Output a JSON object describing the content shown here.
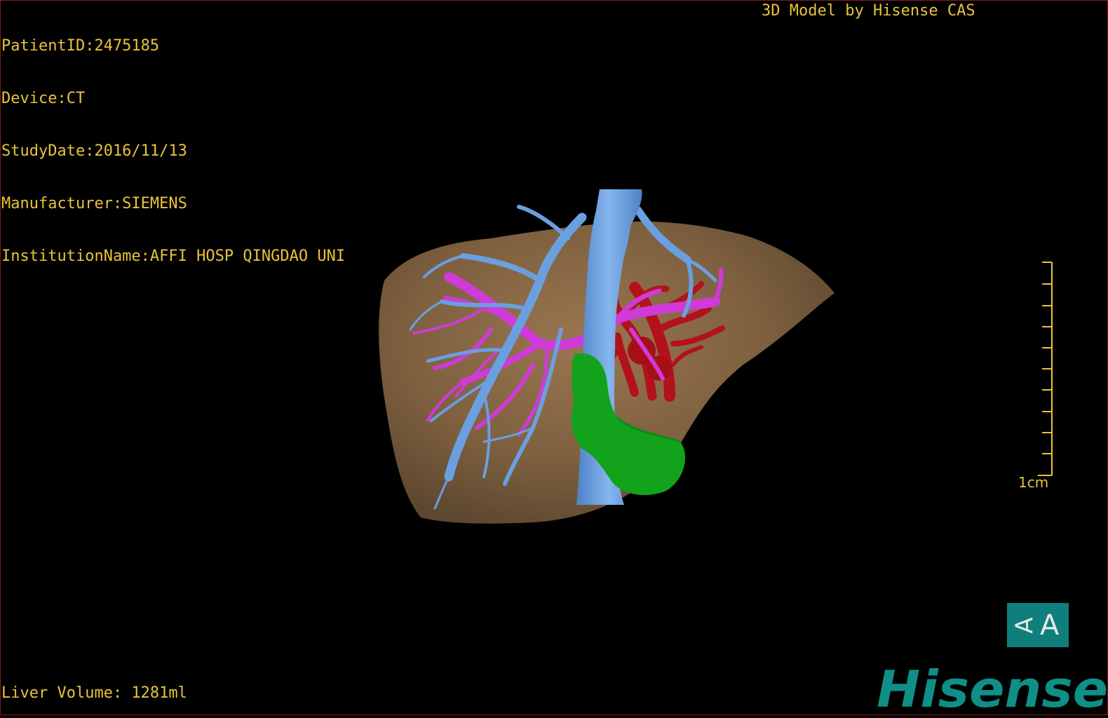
{
  "patient_info": {
    "patient_id": "PatientID:2475185",
    "device": "Device:CT",
    "study_date": "StudyDate:2016/11/13",
    "manufacturer": "Manufacturer:SIEMENS",
    "institution": "InstitutionName:AFFI HOSP QINGDAO UNI"
  },
  "credit": "3D Model by Hisense CAS",
  "liver_volume": "Liver Volume: 1281ml",
  "scale_bar": {
    "label": "1cm"
  },
  "orientation_button": {
    "left_glyph": "A",
    "right_glyph": "A"
  },
  "brand": {
    "name": "Hisense",
    "color": "#0f8f86"
  },
  "colors": {
    "overlay_text": "#e8c33a",
    "liver": "#8d6b47",
    "hepatic_vein": "#6a9fe0",
    "portal_vein": "#d03ad8",
    "artery": "#b3121a",
    "gallbladder": "#13a21b",
    "background": "#000000"
  }
}
